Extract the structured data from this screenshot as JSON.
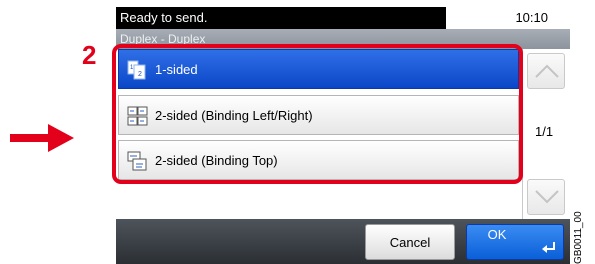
{
  "status": {
    "message": "Ready to send.",
    "time": "10:10"
  },
  "title": "Duplex - Duplex",
  "options": [
    {
      "label": "1-sided",
      "icon": "one-sided-icon",
      "selected": true
    },
    {
      "label": "2-sided (Binding Left/Right)",
      "icon": "two-sided-left-right-icon",
      "selected": false
    },
    {
      "label": "2-sided (Binding Top)",
      "icon": "two-sided-top-icon",
      "selected": false
    }
  ],
  "pagination": {
    "indicator": "1/1"
  },
  "buttons": {
    "cancel": "Cancel",
    "ok": "OK"
  },
  "annotation": {
    "step": "2",
    "code": "GB0011_00"
  },
  "colors": {
    "selected": "#0a47c8",
    "highlight": "#e2001a",
    "ok": "#0b5fd8"
  }
}
